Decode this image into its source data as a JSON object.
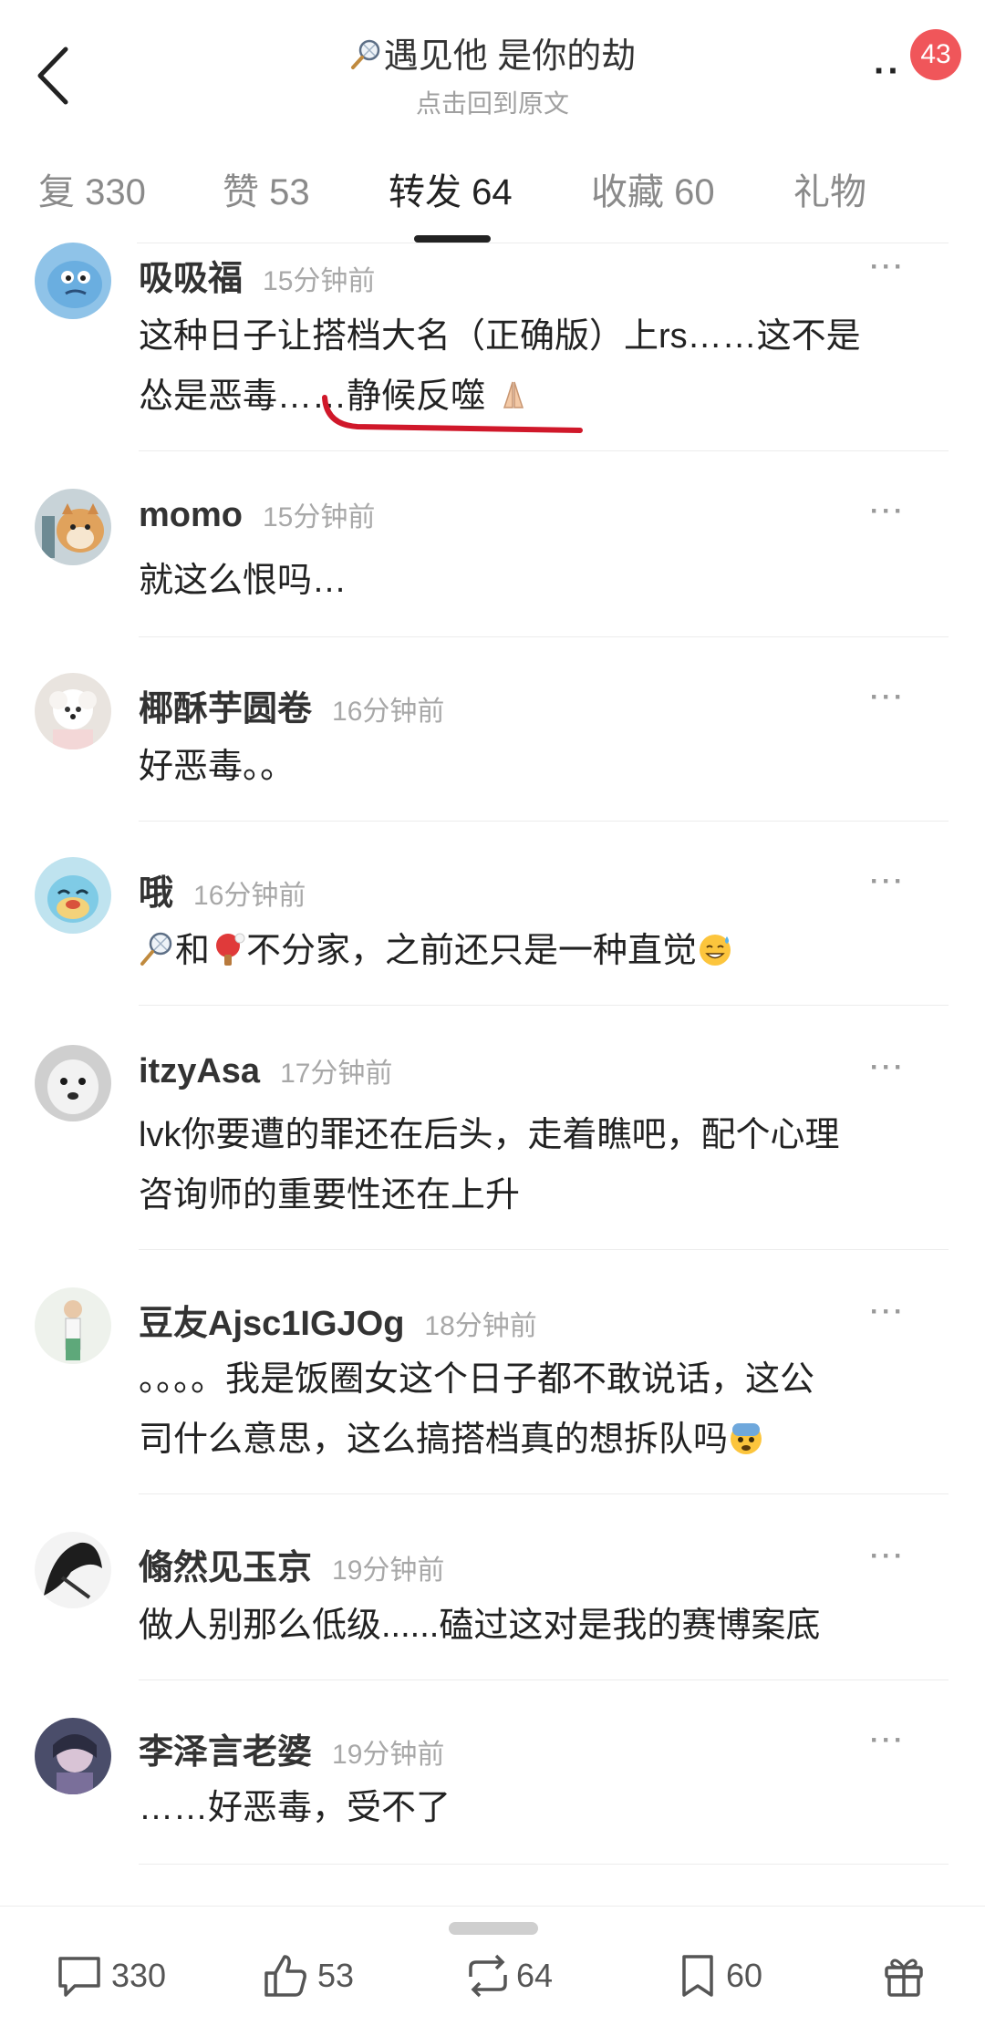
{
  "header": {
    "title": "遇见他 是你的劫",
    "subtitle": "点击回到原文",
    "badge": "43"
  },
  "tabs": [
    {
      "label": "复 330"
    },
    {
      "label": "赞 53"
    },
    {
      "label": "转发 64"
    },
    {
      "label": "收藏 60"
    },
    {
      "label": "礼物"
    }
  ],
  "comments": [
    {
      "name": "吸吸福",
      "time": "15分钟前",
      "text1": "这种日子让搭档大名（正确版）上rs……这不是",
      "text2": "怂是恶毒……静候反噬"
    },
    {
      "name": "momo",
      "time": "15分钟前",
      "text1": "就这么恨吗…"
    },
    {
      "name": "椰酥芋圆卷",
      "time": "16分钟前",
      "text1": "好恶毒。。"
    },
    {
      "name": "哦",
      "time": "16分钟前",
      "text_a": "和",
      "text_b": "不分家，之前还只是一种直觉"
    },
    {
      "name": "itzyAsa",
      "time": "17分钟前",
      "text1": "lvk你要遭的罪还在后头，走着瞧吧，配个心理",
      "text2": "咨询师的重要性还在上升"
    },
    {
      "name": "豆友Ajsc1IGJOg",
      "time": "18分钟前",
      "text1": "。。。。我是饭圈女这个日子都不敢说话，这公",
      "text2": "司什么意思，这么搞搭档真的想拆队吗"
    },
    {
      "name": "翛然见玉京",
      "time": "19分钟前",
      "text1": "做人别那么低级......磕过这对是我的赛博案底"
    },
    {
      "name": "李泽言老婆",
      "time": "19分钟前",
      "text1": "……好恶毒，受不了"
    }
  ],
  "bottom_bar": {
    "comments": "330",
    "likes": "53",
    "reposts": "64",
    "favorites": "60"
  },
  "icons": [
    "back-icon",
    "badminton-icon",
    "more-icon",
    "ping-pong-icon",
    "sweat-emoji-icon",
    "fearful-emoji-icon",
    "folded-hands-icon",
    "comment-icon",
    "like-icon",
    "repost-icon",
    "bookmark-icon",
    "gift-icon"
  ],
  "colors": {
    "badge": "#f0565a",
    "underline_annotation": "#d0182a",
    "active_tab": "#222222",
    "muted": "#a8a8a8"
  }
}
